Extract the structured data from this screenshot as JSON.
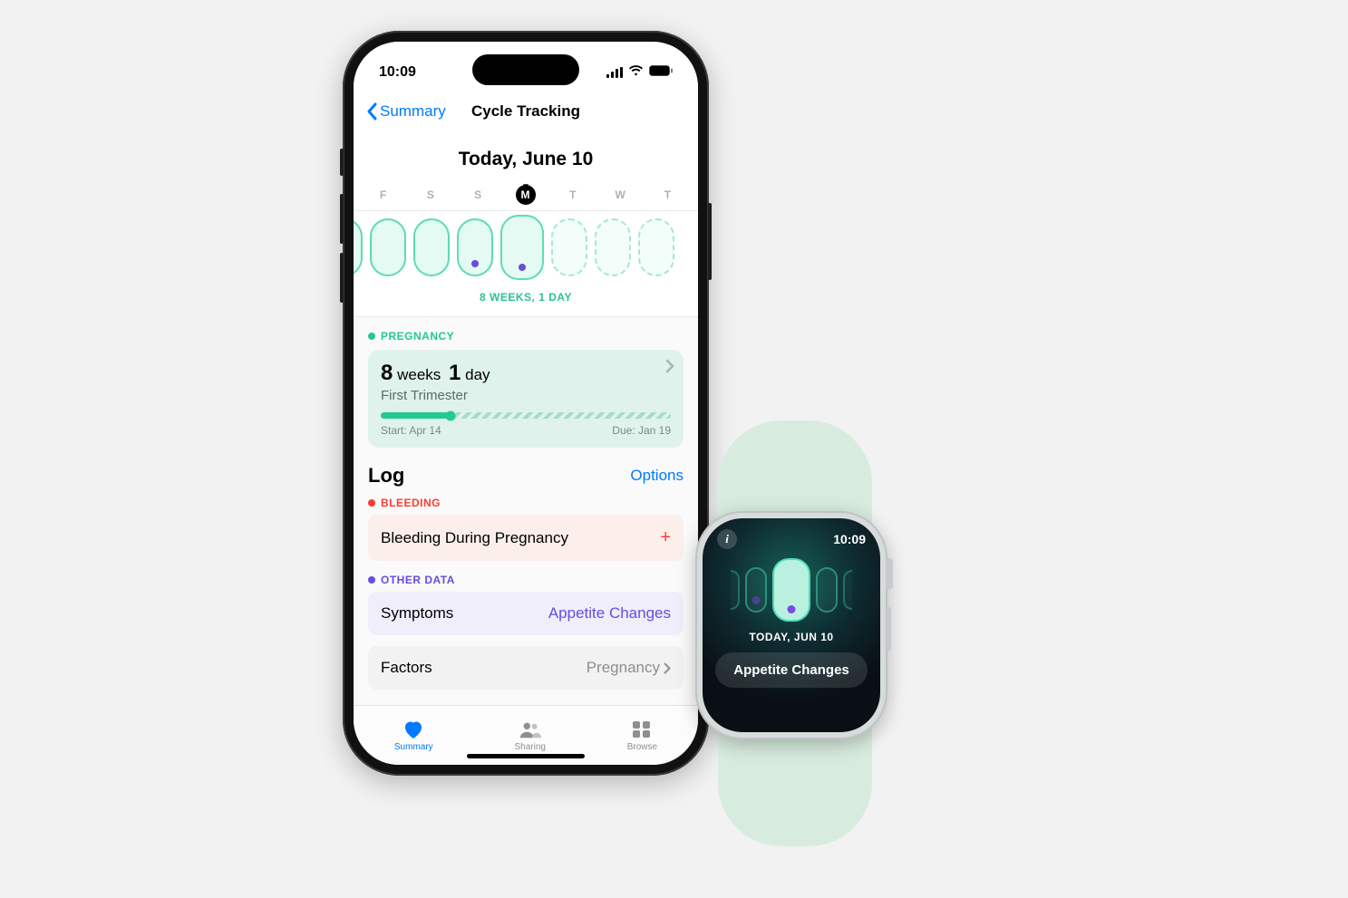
{
  "phone": {
    "status_time": "10:09",
    "nav": {
      "back_label": "Summary",
      "title": "Cycle Tracking"
    },
    "date_heading": "Today, June 10",
    "weekdays": [
      "F",
      "S",
      "S",
      "M",
      "T",
      "W",
      "T"
    ],
    "weeks_label": "8 WEEKS, 1 DAY",
    "pregnancy": {
      "section_label": "PREGNANCY",
      "weeks_num": "8",
      "weeks_unit": "weeks",
      "days_num": "1",
      "days_unit": "day",
      "trimester": "First Trimester",
      "start_label": "Start: Apr 14",
      "due_label": "Due: Jan 19"
    },
    "log": {
      "heading": "Log",
      "options_label": "Options",
      "bleeding_section": "BLEEDING",
      "bleeding_row": "Bleeding During Pregnancy",
      "other_section": "OTHER DATA",
      "symptoms_label": "Symptoms",
      "symptoms_value": "Appetite Changes",
      "factors_label": "Factors",
      "factors_value": "Pregnancy"
    },
    "tabs": {
      "summary": "Summary",
      "sharing": "Sharing",
      "browse": "Browse"
    }
  },
  "watch": {
    "status_time": "10:09",
    "date_label": "TODAY, JUN 10",
    "chip_label": "Appetite Changes"
  },
  "colors": {
    "accent_blue": "#007aff",
    "pregnancy_green": "#22c991",
    "bleeding_red": "#ff3b30",
    "other_purple": "#6a4be0"
  }
}
